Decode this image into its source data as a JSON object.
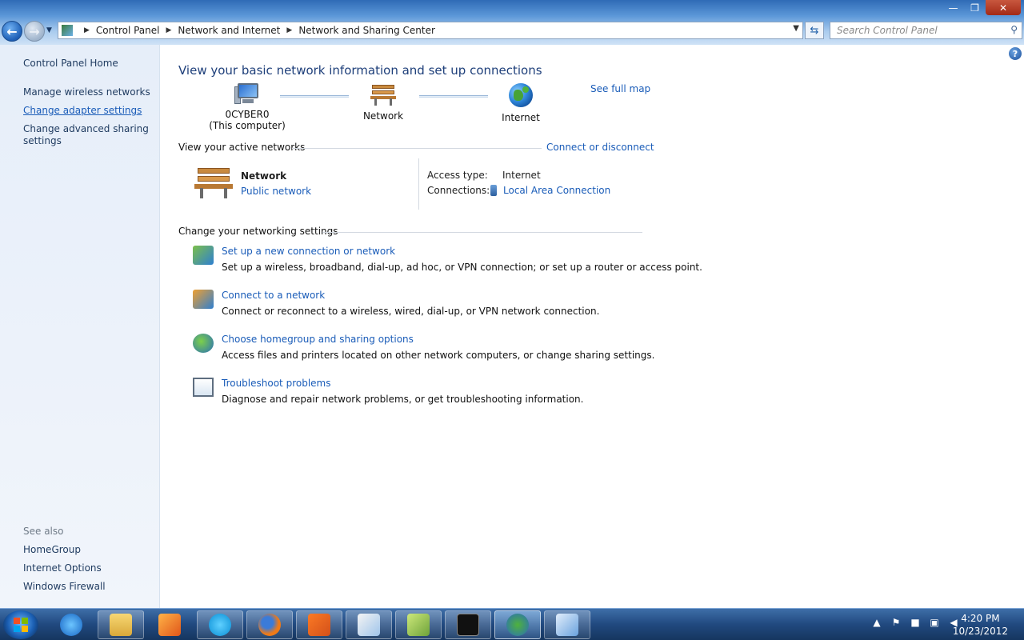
{
  "window": {
    "minimize": "—",
    "restore": "❐",
    "close": "✕"
  },
  "address": {
    "crumbs": [
      "Control Panel",
      "Network and Internet",
      "Network and Sharing Center"
    ],
    "search_placeholder": "Search Control Panel"
  },
  "sidebar": {
    "home": "Control Panel Home",
    "tasks": [
      "Manage wireless networks",
      "Change adapter settings",
      "Change advanced sharing settings"
    ],
    "see_also_label": "See also",
    "see_also": [
      "HomeGroup",
      "Internet Options",
      "Windows Firewall"
    ]
  },
  "main": {
    "heading": "View your basic network information and set up connections",
    "see_full_map": "See full map",
    "map": {
      "computer_name": "0CYBER0",
      "computer_sub": "(This computer)",
      "network": "Network",
      "internet": "Internet"
    },
    "active_networks_label": "View your active networks",
    "connect_or_disconnect": "Connect or disconnect",
    "active": {
      "name": "Network",
      "type": "Public network",
      "access_type_label": "Access type:",
      "access_type_value": "Internet",
      "connections_label": "Connections:",
      "connections_value": "Local Area Connection"
    },
    "change_settings_label": "Change your networking settings",
    "tasks": [
      {
        "link": "Set up a new connection or network",
        "desc": "Set up a wireless, broadband, dial-up, ad hoc, or VPN connection; or set up a router or access point."
      },
      {
        "link": "Connect to a network",
        "desc": "Connect or reconnect to a wireless, wired, dial-up, or VPN network connection."
      },
      {
        "link": "Choose homegroup and sharing options",
        "desc": "Access files and printers located on other network computers, or change sharing settings."
      },
      {
        "link": "Troubleshoot problems",
        "desc": "Diagnose and repair network problems, or get troubleshooting information."
      }
    ]
  },
  "taskbar": {
    "time": "4:20 PM",
    "date": "10/23/2012"
  }
}
